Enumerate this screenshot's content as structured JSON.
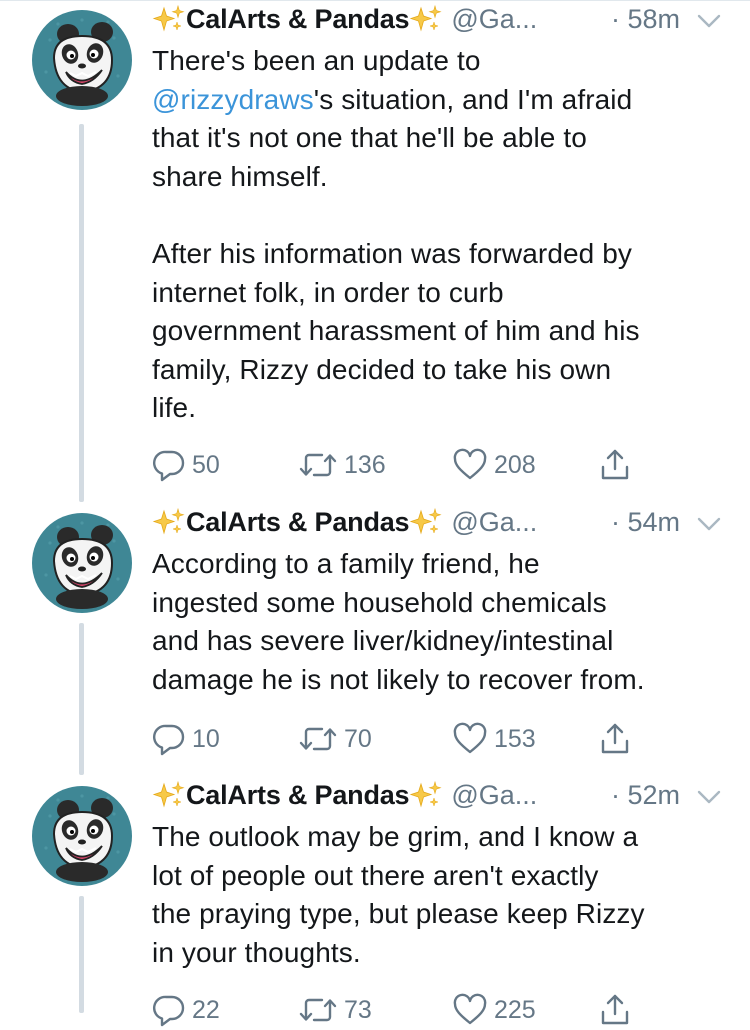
{
  "author": {
    "display_name": "CalArts & Pandas",
    "handle": "@Ga...",
    "sparkle_emoji": "✨"
  },
  "colors": {
    "link": "#3b94d9",
    "secondary_text": "#657786",
    "thread_line": "#d3dbe2",
    "avatar_bg": "#3f8795"
  },
  "tweets": [
    {
      "time": "· 58m",
      "mention": "@rizzydraws",
      "text_before": "There's been an update to\n",
      "text_after": "'s situation, and I'm afraid\nthat it's not one that he'll be able to\nshare himself.\n\nAfter his information was forwarded by\ninternet folk, in order to curb\ngovernment harassment of him and his\nfamily, Rizzy decided to take his own\nlife.",
      "replies": "50",
      "retweets": "136",
      "likes": "208"
    },
    {
      "time": "· 54m",
      "text": "According to a family friend, he\ningested some household chemicals\nand has severe liver/kidney/intestinal\ndamage he is not likely to recover from.",
      "replies": "10",
      "retweets": "70",
      "likes": "153"
    },
    {
      "time": "· 52m",
      "text": "The outlook may be grim, and I know a\nlot of people out there aren't exactly\nthe praying type, but please keep Rizzy\nin your thoughts.",
      "replies": "22",
      "retweets": "73",
      "likes": "225"
    }
  ]
}
